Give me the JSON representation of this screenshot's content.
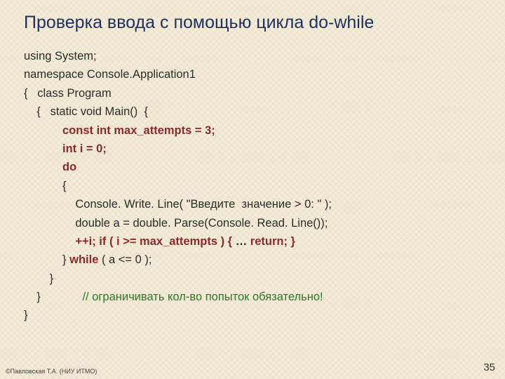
{
  "title": "Проверка ввода с помощью цикла do-while",
  "code": {
    "l1": "using System;",
    "l2": "namespace Console.Application1",
    "l3": "{   class Program",
    "l4": "    {   static void Main()  {",
    "l5_a": "            const int max_attempts = 3;",
    "l6_a": "            int i = 0;",
    "l7_kw": "            do",
    "l8": "            {",
    "l9": "                Console. Write. Line( \"Введите  значение > 0: \" );",
    "l10": "                double a = double. Parse(Console. Read. Line());",
    "l11_a": "                ++i; if ( i >= max_attempts ) { ",
    "l11_b": "…",
    "l11_c": " return; }",
    "l12_a": "            } ",
    "l12_kw": "while",
    "l12_b": " ( a <= 0 );",
    "l13": "        }",
    "l14_a": "    }",
    "l14_cmt": "             // ограничивать кол-во попыток обязательно!",
    "l15": "}"
  },
  "footer": "©Павловская Т.А. (НИУ ИТМО)",
  "page": "35"
}
